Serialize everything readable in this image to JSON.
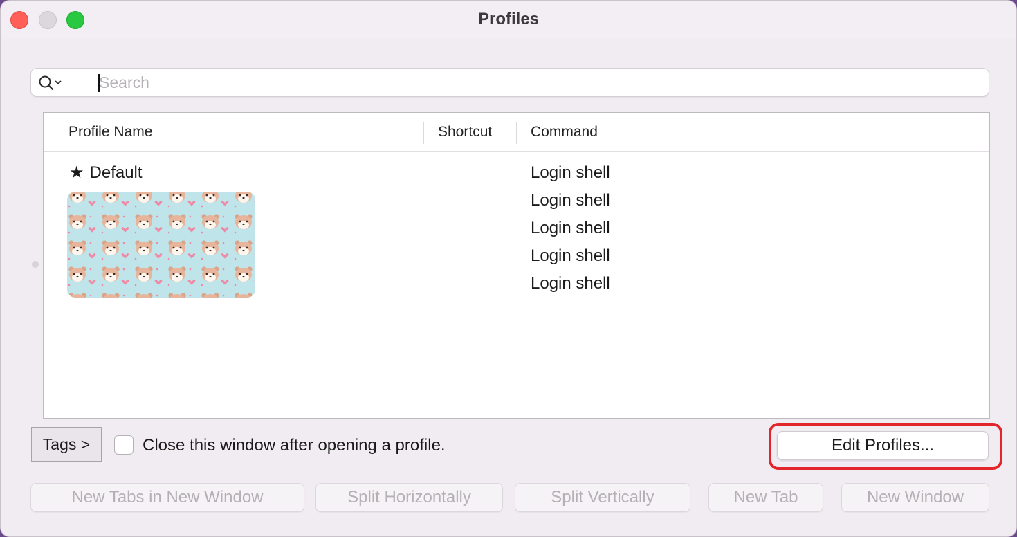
{
  "window": {
    "title": "Profiles"
  },
  "search": {
    "placeholder": "Search",
    "icon": "magnifier-with-dropdown"
  },
  "table": {
    "columns": {
      "name": "Profile Name",
      "shortcut": "Shortcut",
      "command": "Command"
    },
    "default_profile": {
      "marker_icon": "star",
      "name": "Default",
      "command": "Login shell"
    },
    "other_commands": [
      "Login shell",
      "Login shell",
      "Login shell",
      "Login shell"
    ]
  },
  "footer": {
    "tags_label": "Tags >",
    "close_after_open_label": "Close this window after opening a profile.",
    "close_after_open_checked": false,
    "edit_profiles_label": "Edit Profiles..."
  },
  "actions": {
    "new_tabs_in_new_window": "New Tabs in New Window",
    "split_horizontally": "Split Horizontally",
    "split_vertically": "Split Vertically",
    "new_tab": "New Tab",
    "new_window": "New Window"
  },
  "colors": {
    "highlight": "#e3262c",
    "close": "#ff5f57",
    "maximize": "#28c840"
  }
}
